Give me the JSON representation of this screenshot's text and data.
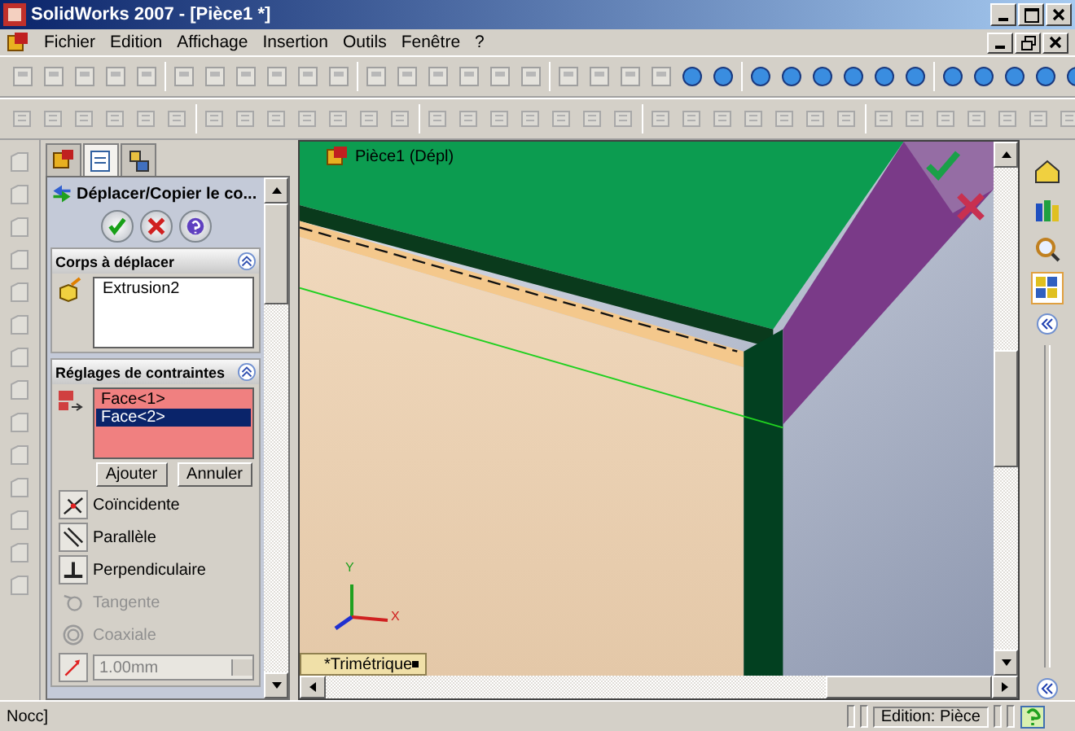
{
  "window": {
    "title": "SolidWorks 2007 - [Pièce1 *]"
  },
  "menu": [
    {
      "label": "Fichier"
    },
    {
      "label": "Edition"
    },
    {
      "label": "Affichage"
    },
    {
      "label": "Insertion"
    },
    {
      "label": "Outils"
    },
    {
      "label": "Fenêtre"
    },
    {
      "label": "?"
    }
  ],
  "manager_tabs": [
    {
      "selected": false
    },
    {
      "selected": true
    },
    {
      "selected": false
    }
  ],
  "property_manager": {
    "title": "Déplacer/Copier le co...",
    "bodies": {
      "title": "Corps à déplacer",
      "items": [
        {
          "label": "Extrusion2"
        }
      ]
    },
    "constraints": {
      "title": "Réglages de contraintes",
      "faces": [
        {
          "label": "Face<1>",
          "selected": false
        },
        {
          "label": "Face<2>",
          "selected": true
        }
      ],
      "buttons": [
        "Ajouter",
        "Annuler"
      ],
      "mates": [
        {
          "label": "Coïncidente",
          "kind": "coincident",
          "disabled": false
        },
        {
          "label": "Parallèle",
          "kind": "parallel",
          "disabled": false
        },
        {
          "label": "Perpendiculaire",
          "kind": "perpendicular",
          "disabled": false
        },
        {
          "label": "Tangente",
          "kind": "tangent",
          "disabled": true
        },
        {
          "label": "Coaxiale",
          "kind": "coaxial",
          "disabled": true
        }
      ],
      "distance": "1.00mm"
    }
  },
  "graphics": {
    "tree_label": "Pièce1 (Dépl)",
    "axis_labels": [
      "Y",
      "X"
    ],
    "view_label": "*Trimétrique"
  },
  "status_bar": {
    "message": "Nocc]",
    "mode": "Edition: Pièce"
  }
}
